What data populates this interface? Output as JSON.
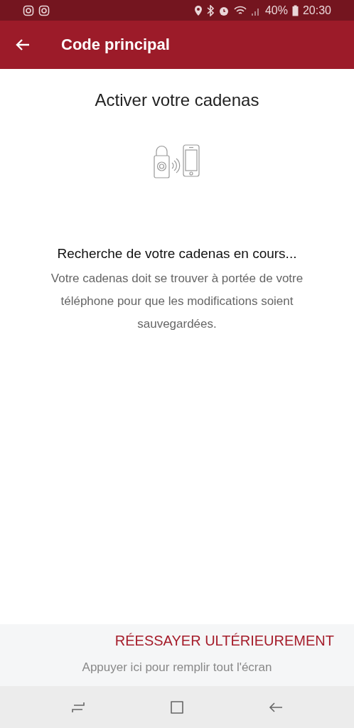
{
  "status_bar": {
    "battery": "40%",
    "time": "20:30"
  },
  "app_bar": {
    "title": "Code principal"
  },
  "content": {
    "title": "Activer votre cadenas",
    "heading": "Recherche de votre cadenas en cours...",
    "message": "Votre cadenas doit se trouver à portée de votre téléphone pour que les modifications soient sauvegardées."
  },
  "actions": {
    "retry_button": "RÉESSAYER ULTÉRIEUREMENT"
  },
  "fullscreen_hint": "Appuyer ici pour remplir tout l'écran"
}
